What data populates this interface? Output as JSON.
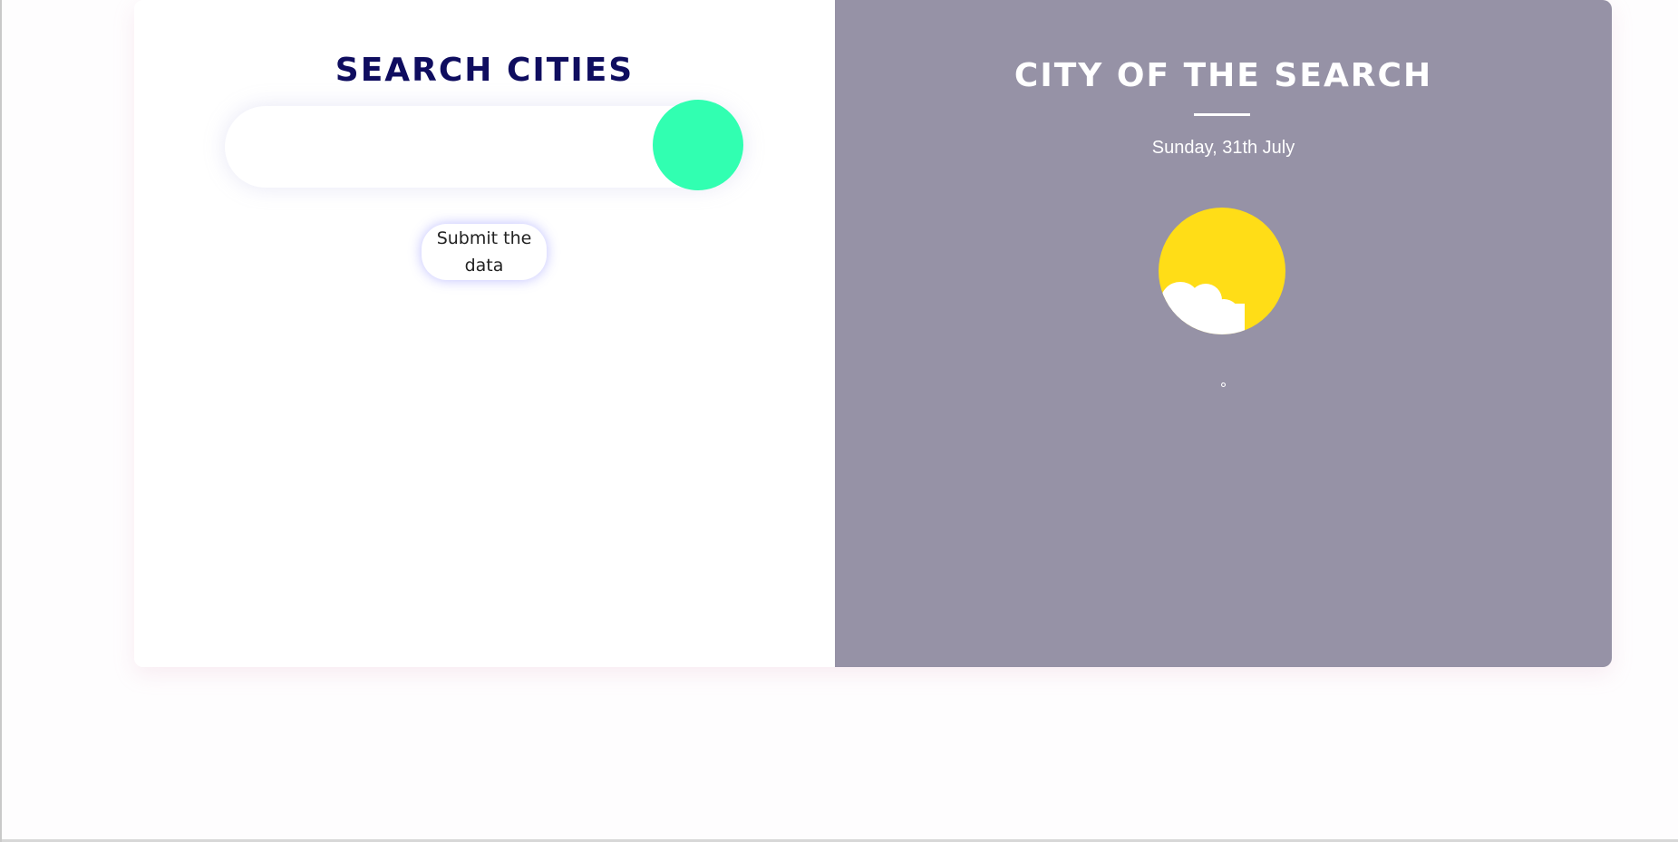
{
  "left_panel": {
    "title": "SEARCH CITIES",
    "search_input": {
      "value": "",
      "placeholder": ""
    },
    "search_button_icon": "circle-button-icon",
    "submit_label": "Submit the data"
  },
  "right_panel": {
    "title": "CITY OF THE SEARCH",
    "date": "Sunday, 31th July",
    "weather_icon": "sun-cloud-icon",
    "temperature": "°"
  },
  "colors": {
    "page_background": "#fefdfe",
    "left_title": "#0f0d5f",
    "right_panel_background": "#9692a6",
    "search_button": "#31ffb1",
    "sun": "#ffdd17",
    "cloud": "#ffffff",
    "submit_shadow": "#6666ff"
  }
}
